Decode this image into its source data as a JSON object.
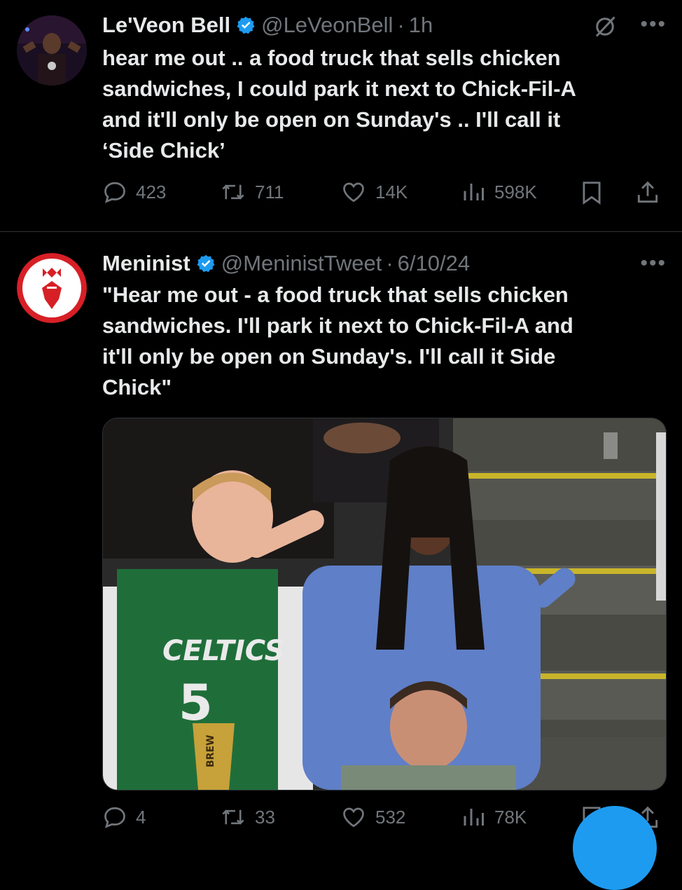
{
  "tweets": [
    {
      "name": "Le'Veon Bell",
      "handle": "@LeVeonBell",
      "dot": "·",
      "time": "1h",
      "text_lines": [
        "hear me out .. a food truck that sells chicken",
        "sandwiches, I could park it next to Chick-Fil-A",
        "and it'll only be open on Sunday's .. I'll call it",
        "‘Side Chick’"
      ],
      "stats": {
        "replies": "423",
        "reposts": "711",
        "likes": "14K",
        "views": "598K"
      }
    },
    {
      "name": "Meninist",
      "handle": "@MeninistTweet",
      "dot": "·",
      "time": "6/10/24",
      "text_lines": [
        "\"Hear me out - a food truck that sells chicken",
        "sandwiches. I'll park it next to Chick-Fil-A and",
        "it'll only be open on Sunday's. I'll call it Side",
        "Chick\""
      ],
      "stats": {
        "replies": "4",
        "reposts": "33",
        "likes": "532",
        "views": "78K"
      }
    }
  ],
  "photo": {
    "jersey_text": "CELTICS",
    "jersey_number": "5",
    "cup_text": "BREW"
  },
  "colors": {
    "background": "#000000",
    "text": "#e7e9ea",
    "muted": "#71767b",
    "verified": "#1d9bf0",
    "divider": "#2f3336",
    "fab": "#1d9bf0"
  },
  "icons": [
    "verified-badge-icon",
    "grok-icon",
    "more-icon",
    "reply-icon",
    "repost-icon",
    "like-icon",
    "views-icon",
    "bookmark-icon",
    "share-icon"
  ]
}
